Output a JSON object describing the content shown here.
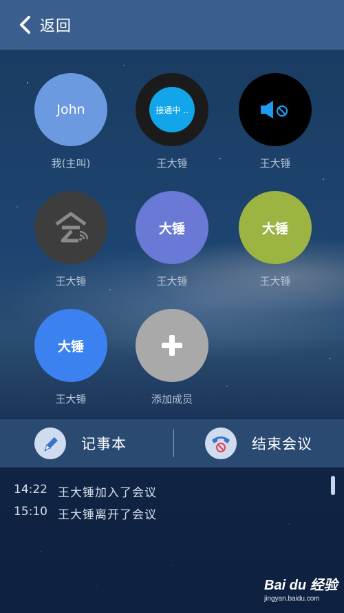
{
  "header": {
    "back_label": "返回"
  },
  "members": [
    {
      "avatar_text": "John",
      "name": "我(主叫)",
      "color": "#6b9ae0",
      "kind": "text"
    },
    {
      "avatar_text": "接通中 ..",
      "name": "王大锤",
      "color": "#1b1b1b",
      "kind": "connecting"
    },
    {
      "avatar_text": "",
      "name": "王大锤",
      "color": "#000000",
      "kind": "muted-speaker"
    },
    {
      "avatar_text": "",
      "name": "王大锤",
      "color": "#3d3d3d",
      "kind": "logo"
    },
    {
      "avatar_text": "大锤",
      "name": "王大锤",
      "color": "#6b79d6",
      "kind": "text"
    },
    {
      "avatar_text": "大锤",
      "name": "王大锤",
      "color": "#9cb542",
      "kind": "text"
    },
    {
      "avatar_text": "大锤",
      "name": "王大锤",
      "color": "#3b82f0",
      "kind": "text"
    },
    {
      "avatar_text": "",
      "name": "添加成员",
      "color": "#a9a9a9",
      "kind": "add"
    }
  ],
  "actions": {
    "notepad_label": "记事本",
    "end_meeting_label": "结束会议"
  },
  "log": [
    {
      "time": "14:22",
      "text": "王大锤加入了会议"
    },
    {
      "time": "15:10",
      "text": "王大锤离开了会议"
    }
  ],
  "watermark": {
    "logo": "Bai du 经验",
    "url": "jingyan.baidu.com"
  },
  "colors": {
    "header": "#3a5f8e",
    "action_bar": "#2a4a72",
    "accent_blue": "#12a5ea"
  }
}
